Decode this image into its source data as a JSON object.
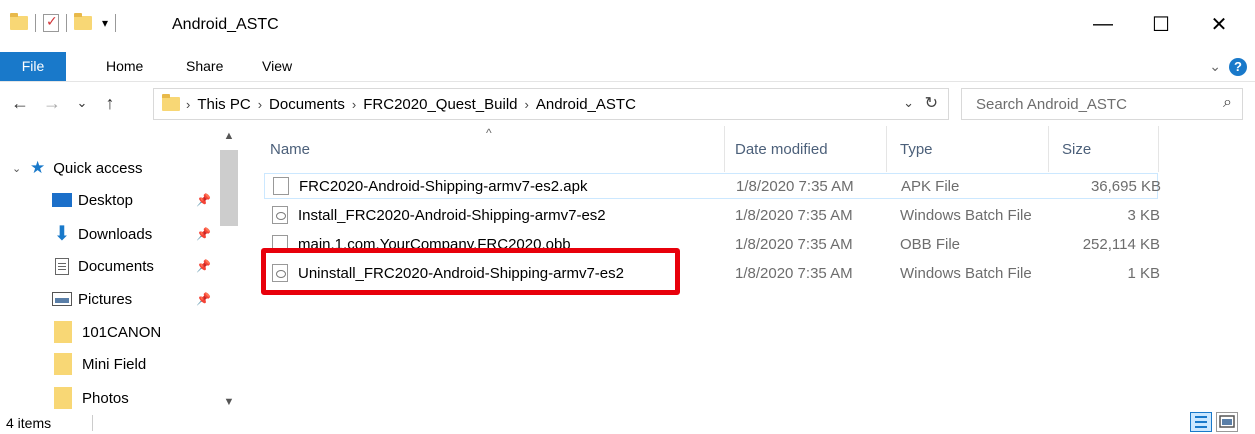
{
  "window": {
    "title": "Android_ASTC",
    "minimize": "—",
    "maximize": "☐",
    "close": "✕",
    "qa_dropdown": "▾"
  },
  "ribbon": {
    "tabs": [
      "File",
      "Home",
      "Share",
      "View"
    ],
    "help": "?",
    "expand": "⌄"
  },
  "nav": {
    "back": "←",
    "forward": "→",
    "recent": "⌄",
    "up": "↑",
    "breadcrumbs": [
      "This PC",
      "Documents",
      "FRC2020_Quest_Build",
      "Android_ASTC"
    ],
    "crumb_separator": "›",
    "addr_dropdown": "⌄",
    "refresh": "↻",
    "search_placeholder": "Search Android_ASTC",
    "search_icon": "⌕"
  },
  "sidebar": {
    "quick_access": "Quick access",
    "items": [
      {
        "label": "Desktop",
        "icon": "desktop-icon",
        "pinned": true
      },
      {
        "label": "Downloads",
        "icon": "downloads-icon",
        "pinned": true
      },
      {
        "label": "Documents",
        "icon": "documents-icon",
        "pinned": true
      },
      {
        "label": "Pictures",
        "icon": "pictures-icon",
        "pinned": true
      },
      {
        "label": "101CANON",
        "icon": "folder-icon",
        "pinned": false
      },
      {
        "label": "Mini Field",
        "icon": "folder-icon",
        "pinned": false
      },
      {
        "label": "Photos",
        "icon": "folder-icon",
        "pinned": false
      }
    ],
    "pin_glyph": "📌",
    "expand_glyph": "⌄",
    "scroll_up": "▲",
    "scroll_down": "▼"
  },
  "columns": {
    "name": "Name",
    "date": "Date modified",
    "type": "Type",
    "size": "Size",
    "sort_indicator": "^"
  },
  "files": [
    {
      "name": "FRC2020-Android-Shipping-armv7-es2.apk",
      "date": "1/8/2020 7:35 AM",
      "type": "APK File",
      "size": "36,695 KB",
      "icon": "apk-file-icon"
    },
    {
      "name": "Install_FRC2020-Android-Shipping-armv7-es2",
      "date": "1/8/2020 7:35 AM",
      "type": "Windows Batch File",
      "size": "3 KB",
      "icon": "batch-file-icon"
    },
    {
      "name": "main.1.com.YourCompany.FRC2020.obb",
      "date": "1/8/2020 7:35 AM",
      "type": "OBB File",
      "size": "252,114 KB",
      "icon": "obb-file-icon"
    },
    {
      "name": "Uninstall_FRC2020-Android-Shipping-armv7-es2",
      "date": "1/8/2020 7:35 AM",
      "type": "Windows Batch File",
      "size": "1 KB",
      "icon": "batch-file-icon"
    }
  ],
  "status": {
    "count": "4 items"
  },
  "colors": {
    "accent": "#1979ca",
    "highlight": "#e8000b",
    "folder": "#f8d775"
  }
}
